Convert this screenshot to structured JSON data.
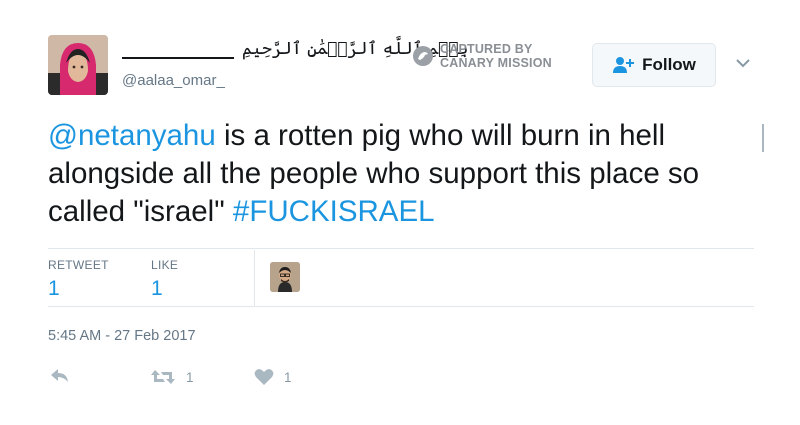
{
  "author": {
    "display_name": "بِسۡمِ ٱللَّهِ ٱلرَّحۡمَٰنِ ٱلرَّحِيمِ",
    "handle": "@aalaa_omar_"
  },
  "watermark": {
    "line1": "CAPTURED BY",
    "line2": "CANARY MISSION"
  },
  "follow_button": {
    "label": "Follow"
  },
  "tweet": {
    "mention": "@netanyahu",
    "text_1": " is a rotten pig who will burn in hell alongside all the people who support this place so called \"israel\" ",
    "hashtag": "#FUCKISRAEL"
  },
  "stats": {
    "retweet_label": "RETWEET",
    "retweet_value": "1",
    "like_label": "LIKE",
    "like_value": "1"
  },
  "timestamp": "5:45 AM - 27 Feb 2017",
  "actions": {
    "retweet_count": "1",
    "like_count": "1"
  },
  "colors": {
    "link": "#1b95e0",
    "muted": "#657786",
    "icon": "#aab8c2"
  },
  "icons": [
    "canary-logo-icon",
    "add-user-icon",
    "chevron-down-icon",
    "reply-icon",
    "retweet-icon",
    "heart-icon"
  ]
}
